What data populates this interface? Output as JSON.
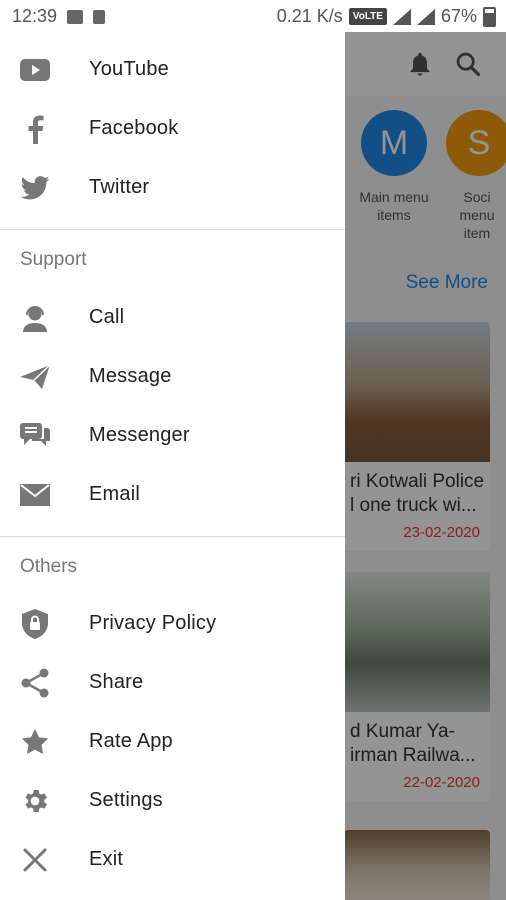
{
  "status_bar": {
    "time": "12:39",
    "net_speed": "0.21 K/s",
    "volte": "VoLTE",
    "battery": "67%"
  },
  "drawer": {
    "social_items": [
      {
        "label": "YouTube",
        "icon": "youtube-icon"
      },
      {
        "label": "Facebook",
        "icon": "facebook-icon"
      },
      {
        "label": "Twitter",
        "icon": "twitter-icon"
      }
    ],
    "support_title": "Support",
    "support_items": [
      {
        "label": "Call",
        "icon": "support-agent-icon"
      },
      {
        "label": "Message",
        "icon": "paper-plane-icon"
      },
      {
        "label": "Messenger",
        "icon": "chat-bubbles-icon"
      },
      {
        "label": "Email",
        "icon": "envelope-icon"
      }
    ],
    "others_title": "Others",
    "others_items": [
      {
        "label": "Privacy Policy",
        "icon": "shield-lock-icon"
      },
      {
        "label": "Share",
        "icon": "share-icon"
      },
      {
        "label": "Rate App",
        "icon": "star-icon"
      },
      {
        "label": "Settings",
        "icon": "gear-icon"
      },
      {
        "label": "Exit",
        "icon": "close-icon"
      }
    ]
  },
  "background": {
    "quick_links": [
      {
        "letter": "M",
        "caption": "Main menu items",
        "color": "#1e88e5"
      },
      {
        "letter": "S",
        "caption": "Soci menu item",
        "color": "#f29d12"
      }
    ],
    "see_more": "See More",
    "news": [
      {
        "title_line1": "ri Kotwali Police",
        "title_line2": "l one truck wi...",
        "date": "23-02-2020"
      },
      {
        "title_line1": "d Kumar Ya-",
        "title_line2": "irman Railwa...",
        "date": "22-02-2020"
      }
    ]
  }
}
